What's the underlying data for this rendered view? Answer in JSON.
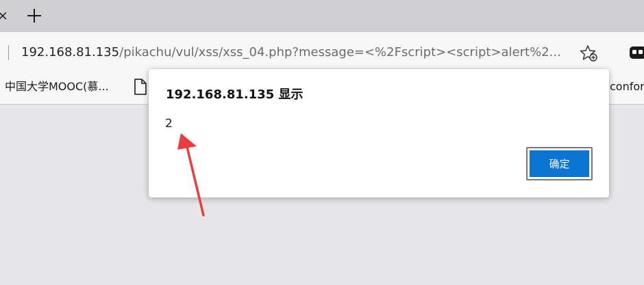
{
  "tabs": {
    "close_glyph": "×",
    "new_tab_icon": "plus-icon"
  },
  "addressbar": {
    "host": "192.168.81.135",
    "path": "/pikachu/vul/xss/xss_04.php?message=<%2Fscript><script>alert%2..."
  },
  "bookmarks": {
    "item1": "中国大学MOOC(慕...",
    "item2_icon": "document-icon",
    "item3": "confor"
  },
  "dialog": {
    "title": "192.168.81.135 显示",
    "message": "2",
    "ok_label": "确定"
  },
  "colors": {
    "accent": "#0a74d1",
    "annotation_arrow": "#ee3b3b"
  }
}
